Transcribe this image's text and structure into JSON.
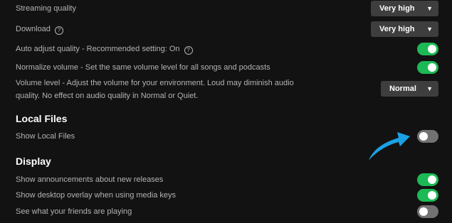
{
  "settings": {
    "streaming_quality": {
      "label": "Streaming quality",
      "value": "Very high"
    },
    "download": {
      "label": "Download",
      "value": "Very high"
    },
    "auto_adjust": {
      "label": "Auto adjust quality - Recommended setting: On",
      "enabled": true
    },
    "normalize": {
      "label": "Normalize volume - Set the same volume level for all songs and podcasts",
      "enabled": true
    },
    "volume_level": {
      "label_line1": "Volume level - Adjust the volume for your environment. Loud may diminish audio",
      "label_line2": "quality. No effect on audio quality in Normal or Quiet.",
      "value": "Normal"
    }
  },
  "local_files": {
    "heading": "Local Files",
    "show_local_files": {
      "label": "Show Local Files",
      "enabled": false
    }
  },
  "display": {
    "heading": "Display",
    "announcements": {
      "label": "Show announcements about new releases",
      "enabled": true
    },
    "overlay": {
      "label": "Show desktop overlay when using media keys",
      "enabled": true
    },
    "friends": {
      "label": "See what your friends are playing",
      "enabled": false
    }
  },
  "icons": {
    "help": "help-circle-icon",
    "chevron": "chevron-down-icon",
    "annotation": "arrow-icon"
  },
  "colors": {
    "background": "#121212",
    "toggle_on": "#1db954",
    "toggle_off": "#727272",
    "arrow": "#1aa1e4"
  }
}
